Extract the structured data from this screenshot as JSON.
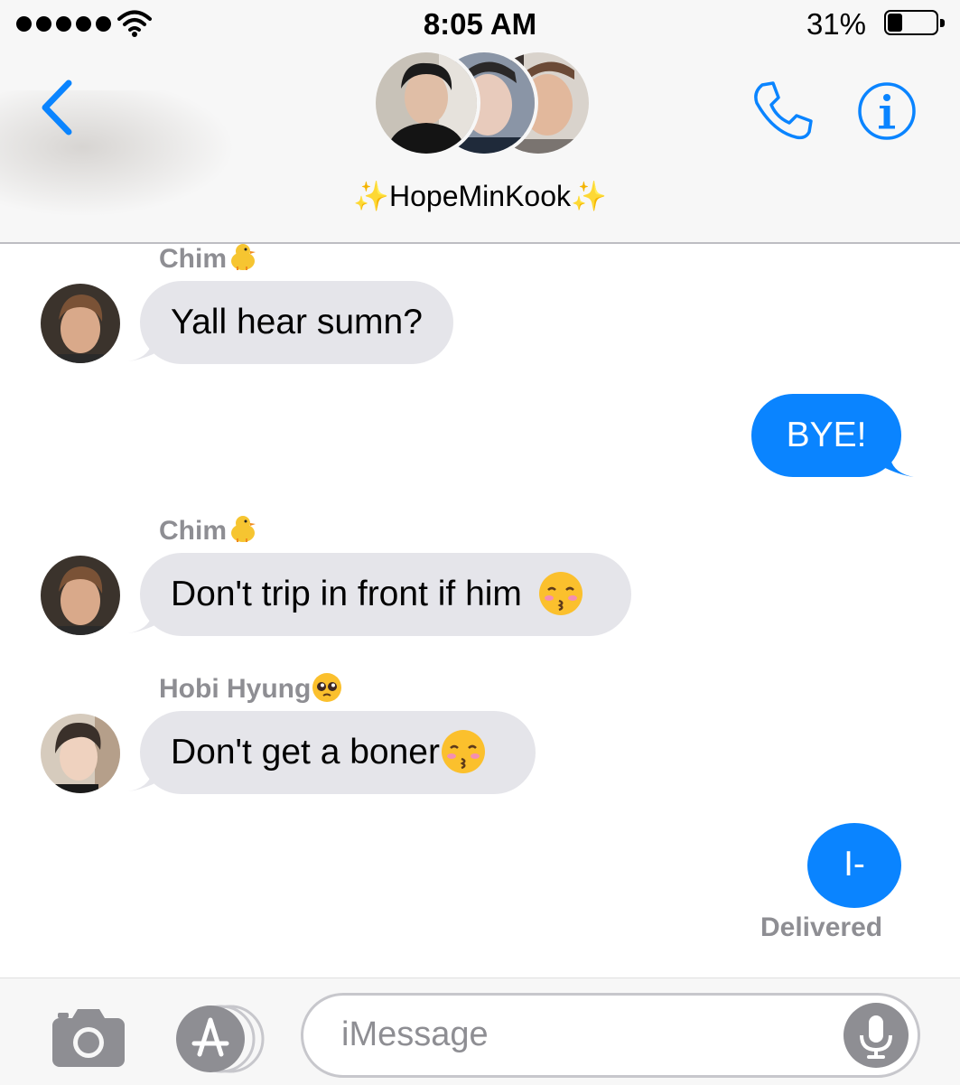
{
  "status_bar": {
    "time": "8:05 AM",
    "battery_percent": "31%",
    "battery_level": 0.31
  },
  "header": {
    "group_name": "✨HopeMinKook✨"
  },
  "messages": [
    {
      "sender": "Chim",
      "text": "Yall hear sumn?"
    },
    {
      "text": "BYE!"
    },
    {
      "sender": "Chim",
      "text": "Don't trip in front if him"
    },
    {
      "sender": "Hobi Hyung",
      "text": "Don't get a boner"
    },
    {
      "text": "I-"
    }
  ],
  "delivery_status": "Delivered",
  "input": {
    "placeholder": "iMessage"
  },
  "colors": {
    "accent": "#0a84ff",
    "incoming_bubble": "#e5e5ea",
    "meta_text": "#8e8e93"
  },
  "icons": [
    "back-chevron-icon",
    "phone-icon",
    "info-icon",
    "camera-icon",
    "app-store-icon",
    "microphone-icon",
    "chick-emoji",
    "pleading-face-emoji",
    "kissing-face-emoji"
  ]
}
